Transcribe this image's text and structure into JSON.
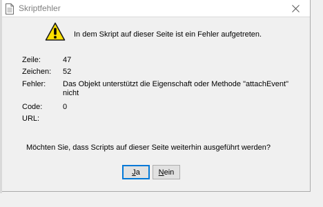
{
  "window": {
    "title": "Skriptfehler",
    "close_glyph": "✕"
  },
  "message": "In dem Skript auf dieser Seite ist ein Fehler aufgetreten.",
  "details": {
    "line": {
      "label": "Zeile:",
      "value": "47"
    },
    "char": {
      "label": "Zeichen:",
      "value": "52"
    },
    "error": {
      "label": "Fehler:",
      "value": "Das Objekt unterstützt die Eigenschaft oder Methode \"attachEvent\" nicht"
    },
    "code": {
      "label": "Code:",
      "value": "0"
    },
    "url": {
      "label": "URL:",
      "value": ""
    }
  },
  "question": "Möchten Sie, dass Scripts auf dieser Seite weiterhin ausgeführt werden?",
  "buttons": {
    "yes": {
      "mnemonic": "J",
      "rest": "a"
    },
    "no": {
      "mnemonic": "N",
      "rest": "ein"
    }
  },
  "icons": {
    "title_icon": "document-icon",
    "warning_icon": "warning-icon",
    "close_icon": "close-icon"
  },
  "colors": {
    "warning_fill": "#ffe100",
    "focus_border": "#0078d7"
  }
}
